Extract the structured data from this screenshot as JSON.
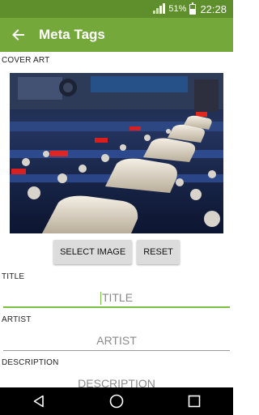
{
  "status_bar": {
    "battery_percent": "51%",
    "time": "22:28",
    "battery_level": 0.51,
    "icons": [
      "signal-icon",
      "battery-icon"
    ]
  },
  "app_bar": {
    "title": "Meta Tags",
    "back_icon": "arrow-back-icon"
  },
  "cover_art": {
    "label": "COVER ART",
    "image": "audio-mixing-console-photo"
  },
  "buttons": {
    "select_image": "SELECT IMAGE",
    "reset": "RESET"
  },
  "fields": {
    "title": {
      "label": "TITLE",
      "placeholder": "TITLE",
      "value": ""
    },
    "artist": {
      "label": "ARTIST",
      "placeholder": "ARTIST",
      "value": ""
    },
    "description": {
      "label": "DESCRIPTION",
      "placeholder": "DESCRIPTION",
      "value": ""
    }
  },
  "nav_bar": {
    "icons": [
      "back-triangle-icon",
      "home-circle-icon",
      "recents-square-icon"
    ]
  },
  "colors": {
    "status_bar": "#5f8f2c",
    "app_bar": "#74a83a",
    "accent": "#7bc043"
  }
}
